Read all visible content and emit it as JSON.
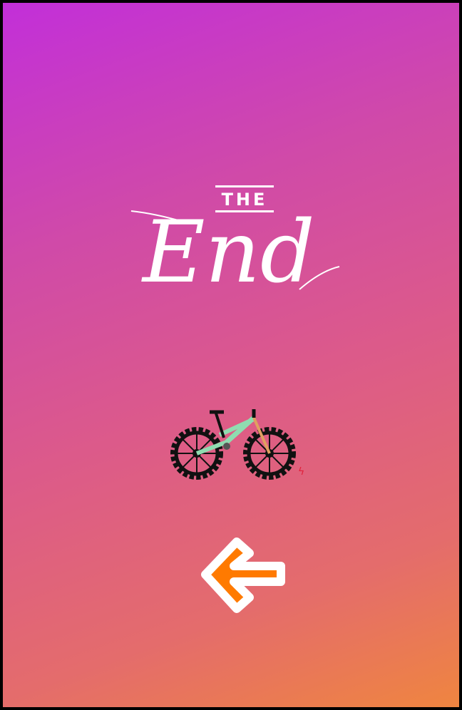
{
  "title": {
    "small": "THE",
    "large": "End"
  },
  "illustration": {
    "name": "mountain-bike",
    "frame_color": "#8fdcb0",
    "wheel_color": "#111111"
  },
  "back_button": {
    "icon": "arrow-left-icon",
    "fill": "#ff7a00",
    "outline": "#ffffff"
  },
  "background": {
    "gradient_start": "#c22fd9",
    "gradient_end": "#ef8540"
  }
}
